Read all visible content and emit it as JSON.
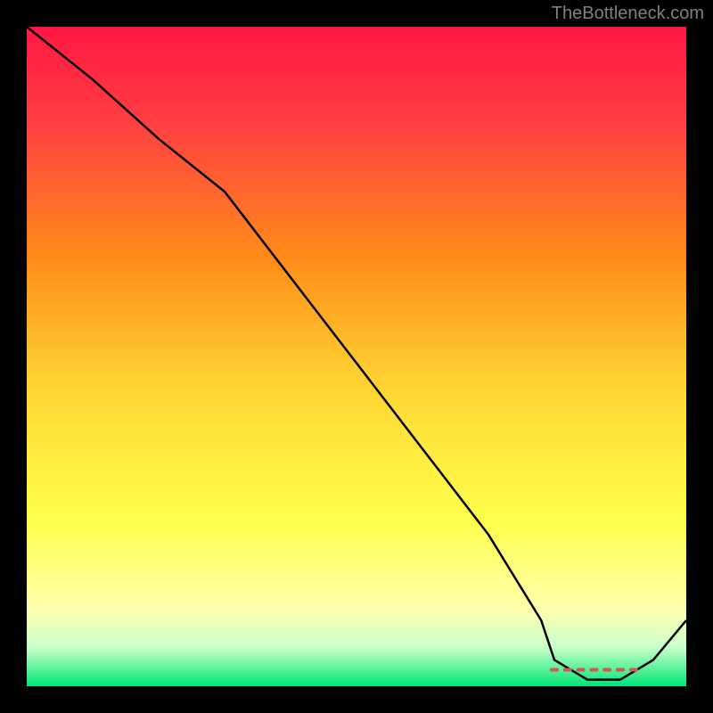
{
  "watermark": "TheBottleneck.com",
  "chart_data": {
    "type": "line",
    "title": "",
    "xlabel": "",
    "ylabel": "",
    "xlim": [
      0,
      100
    ],
    "ylim": [
      0,
      100
    ],
    "background": {
      "type": "linear-gradient",
      "direction": "vertical",
      "stops": [
        {
          "pos": 0.0,
          "color": "#ff1744"
        },
        {
          "pos": 0.15,
          "color": "#ff4040"
        },
        {
          "pos": 0.35,
          "color": "#ff8c1a"
        },
        {
          "pos": 0.55,
          "color": "#ffd633"
        },
        {
          "pos": 0.75,
          "color": "#ffff4d"
        },
        {
          "pos": 0.88,
          "color": "#ffffaa"
        },
        {
          "pos": 0.94,
          "color": "#ccffcc"
        },
        {
          "pos": 1.0,
          "color": "#00e676"
        }
      ]
    },
    "series": [
      {
        "name": "bottleneck-curve",
        "color": "#000000",
        "x": [
          0,
          10,
          20,
          30,
          40,
          50,
          60,
          70,
          78,
          80,
          85,
          90,
          95,
          100
        ],
        "y": [
          100,
          92,
          83,
          75,
          62,
          49,
          36,
          23,
          10,
          4,
          1,
          1,
          4,
          10
        ]
      }
    ],
    "optimal_markers": {
      "name": "optimal-range",
      "color": "#d9534f",
      "y": 2.5,
      "x": [
        80,
        82,
        84,
        86,
        88,
        90,
        92
      ]
    }
  }
}
